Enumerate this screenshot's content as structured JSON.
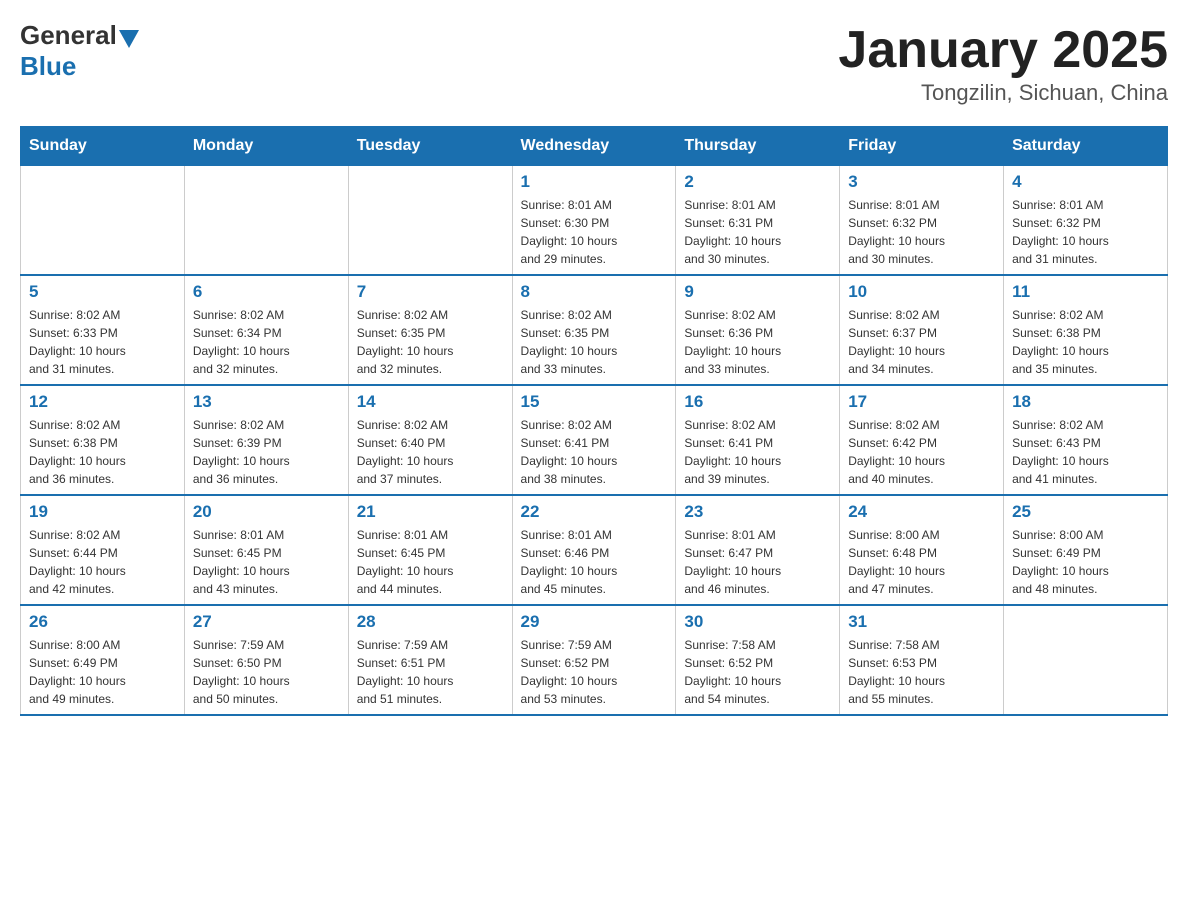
{
  "header": {
    "logo_general": "General",
    "logo_blue": "Blue",
    "title": "January 2025",
    "subtitle": "Tongzilin, Sichuan, China"
  },
  "weekdays": [
    "Sunday",
    "Monday",
    "Tuesday",
    "Wednesday",
    "Thursday",
    "Friday",
    "Saturday"
  ],
  "weeks": [
    [
      {
        "day": "",
        "info": ""
      },
      {
        "day": "",
        "info": ""
      },
      {
        "day": "",
        "info": ""
      },
      {
        "day": "1",
        "info": "Sunrise: 8:01 AM\nSunset: 6:30 PM\nDaylight: 10 hours\nand 29 minutes."
      },
      {
        "day": "2",
        "info": "Sunrise: 8:01 AM\nSunset: 6:31 PM\nDaylight: 10 hours\nand 30 minutes."
      },
      {
        "day": "3",
        "info": "Sunrise: 8:01 AM\nSunset: 6:32 PM\nDaylight: 10 hours\nand 30 minutes."
      },
      {
        "day": "4",
        "info": "Sunrise: 8:01 AM\nSunset: 6:32 PM\nDaylight: 10 hours\nand 31 minutes."
      }
    ],
    [
      {
        "day": "5",
        "info": "Sunrise: 8:02 AM\nSunset: 6:33 PM\nDaylight: 10 hours\nand 31 minutes."
      },
      {
        "day": "6",
        "info": "Sunrise: 8:02 AM\nSunset: 6:34 PM\nDaylight: 10 hours\nand 32 minutes."
      },
      {
        "day": "7",
        "info": "Sunrise: 8:02 AM\nSunset: 6:35 PM\nDaylight: 10 hours\nand 32 minutes."
      },
      {
        "day": "8",
        "info": "Sunrise: 8:02 AM\nSunset: 6:35 PM\nDaylight: 10 hours\nand 33 minutes."
      },
      {
        "day": "9",
        "info": "Sunrise: 8:02 AM\nSunset: 6:36 PM\nDaylight: 10 hours\nand 33 minutes."
      },
      {
        "day": "10",
        "info": "Sunrise: 8:02 AM\nSunset: 6:37 PM\nDaylight: 10 hours\nand 34 minutes."
      },
      {
        "day": "11",
        "info": "Sunrise: 8:02 AM\nSunset: 6:38 PM\nDaylight: 10 hours\nand 35 minutes."
      }
    ],
    [
      {
        "day": "12",
        "info": "Sunrise: 8:02 AM\nSunset: 6:38 PM\nDaylight: 10 hours\nand 36 minutes."
      },
      {
        "day": "13",
        "info": "Sunrise: 8:02 AM\nSunset: 6:39 PM\nDaylight: 10 hours\nand 36 minutes."
      },
      {
        "day": "14",
        "info": "Sunrise: 8:02 AM\nSunset: 6:40 PM\nDaylight: 10 hours\nand 37 minutes."
      },
      {
        "day": "15",
        "info": "Sunrise: 8:02 AM\nSunset: 6:41 PM\nDaylight: 10 hours\nand 38 minutes."
      },
      {
        "day": "16",
        "info": "Sunrise: 8:02 AM\nSunset: 6:41 PM\nDaylight: 10 hours\nand 39 minutes."
      },
      {
        "day": "17",
        "info": "Sunrise: 8:02 AM\nSunset: 6:42 PM\nDaylight: 10 hours\nand 40 minutes."
      },
      {
        "day": "18",
        "info": "Sunrise: 8:02 AM\nSunset: 6:43 PM\nDaylight: 10 hours\nand 41 minutes."
      }
    ],
    [
      {
        "day": "19",
        "info": "Sunrise: 8:02 AM\nSunset: 6:44 PM\nDaylight: 10 hours\nand 42 minutes."
      },
      {
        "day": "20",
        "info": "Sunrise: 8:01 AM\nSunset: 6:45 PM\nDaylight: 10 hours\nand 43 minutes."
      },
      {
        "day": "21",
        "info": "Sunrise: 8:01 AM\nSunset: 6:45 PM\nDaylight: 10 hours\nand 44 minutes."
      },
      {
        "day": "22",
        "info": "Sunrise: 8:01 AM\nSunset: 6:46 PM\nDaylight: 10 hours\nand 45 minutes."
      },
      {
        "day": "23",
        "info": "Sunrise: 8:01 AM\nSunset: 6:47 PM\nDaylight: 10 hours\nand 46 minutes."
      },
      {
        "day": "24",
        "info": "Sunrise: 8:00 AM\nSunset: 6:48 PM\nDaylight: 10 hours\nand 47 minutes."
      },
      {
        "day": "25",
        "info": "Sunrise: 8:00 AM\nSunset: 6:49 PM\nDaylight: 10 hours\nand 48 minutes."
      }
    ],
    [
      {
        "day": "26",
        "info": "Sunrise: 8:00 AM\nSunset: 6:49 PM\nDaylight: 10 hours\nand 49 minutes."
      },
      {
        "day": "27",
        "info": "Sunrise: 7:59 AM\nSunset: 6:50 PM\nDaylight: 10 hours\nand 50 minutes."
      },
      {
        "day": "28",
        "info": "Sunrise: 7:59 AM\nSunset: 6:51 PM\nDaylight: 10 hours\nand 51 minutes."
      },
      {
        "day": "29",
        "info": "Sunrise: 7:59 AM\nSunset: 6:52 PM\nDaylight: 10 hours\nand 53 minutes."
      },
      {
        "day": "30",
        "info": "Sunrise: 7:58 AM\nSunset: 6:52 PM\nDaylight: 10 hours\nand 54 minutes."
      },
      {
        "day": "31",
        "info": "Sunrise: 7:58 AM\nSunset: 6:53 PM\nDaylight: 10 hours\nand 55 minutes."
      },
      {
        "day": "",
        "info": ""
      }
    ]
  ]
}
